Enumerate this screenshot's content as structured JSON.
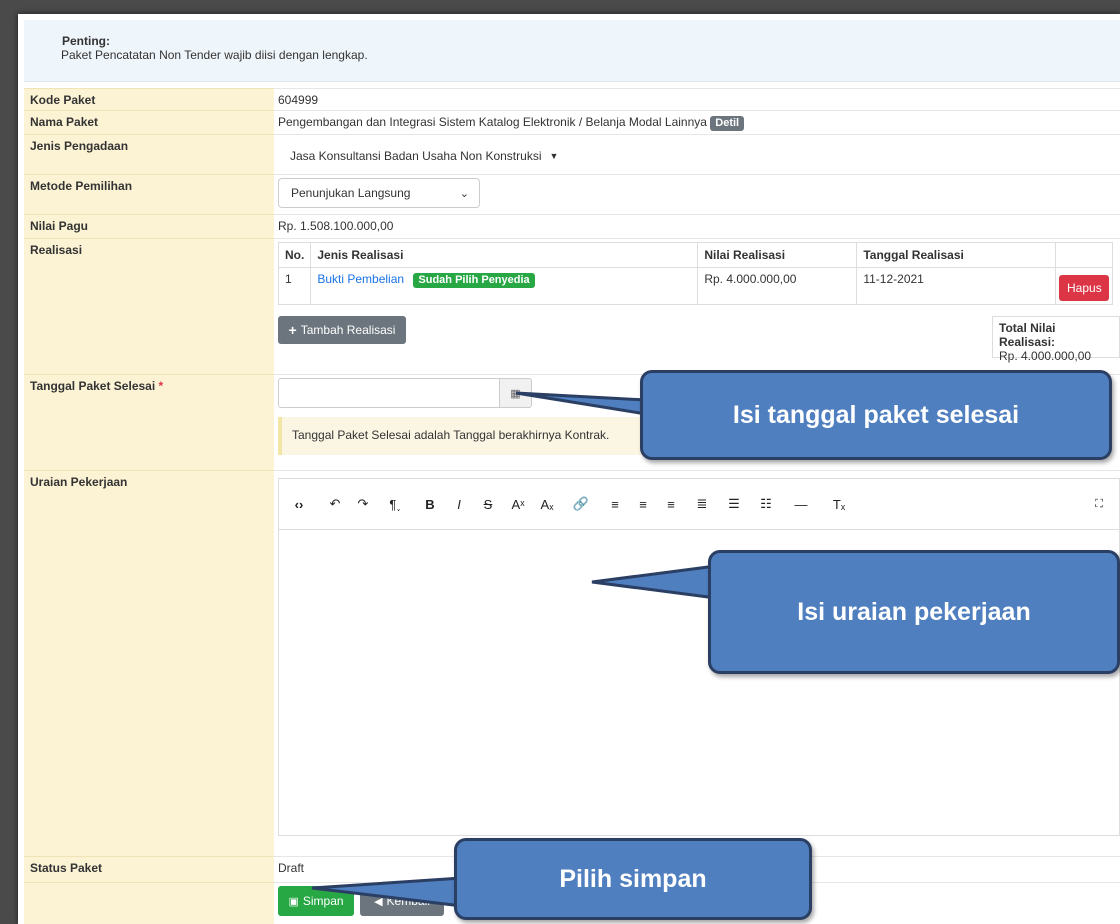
{
  "alert": {
    "title": "Penting:",
    "message": "Paket Pencatatan Non Tender wajib diisi dengan lengkap."
  },
  "form": {
    "kode_paket": {
      "label": "Kode Paket",
      "value": "604999"
    },
    "nama_paket": {
      "label": "Nama Paket",
      "value": "Pengembangan dan Integrasi Sistem Katalog Elektronik / Belanja Modal Lainnya",
      "badge": "Detil"
    },
    "jenis_pengadaan": {
      "label": "Jenis Pengadaan",
      "value": "Jasa Konsultansi Badan Usaha Non Konstruksi"
    },
    "metode_pemilihan": {
      "label": "Metode Pemilihan",
      "value": "Penunjukan Langsung"
    },
    "nilai_pagu": {
      "label": "Nilai Pagu",
      "value": "Rp. 1.508.100.000,00"
    },
    "realisasi": {
      "label": "Realisasi",
      "headers": [
        "No.",
        "Jenis Realisasi",
        "Nilai Realisasi",
        "Tanggal Realisasi"
      ],
      "rows": [
        {
          "no": "1",
          "jenis": "Bukti Pembelian",
          "badge": "Sudah Pilih Penyedia",
          "nilai": "Rp. 4.000.000,00",
          "tanggal": "11-12-2021",
          "action": "Hapus"
        }
      ],
      "add_button": "Tambah Realisasi",
      "total_label": "Total Nilai Realisasi:",
      "total_value": "Rp. 4.000.000,00"
    },
    "tanggal_selesai": {
      "label": "Tanggal Paket Selesai",
      "required": "*",
      "value": "",
      "hint": "Tanggal Paket Selesai adalah Tanggal berakhirnya Kontrak."
    },
    "uraian": {
      "label": "Uraian Pekerjaan"
    },
    "status": {
      "label": "Status Paket",
      "value": "Draft"
    },
    "buttons": {
      "simpan": "Simpan",
      "kembali": "Kembali"
    }
  },
  "callouts": {
    "tanggal": "Isi tanggal paket selesai",
    "uraian": "Isi uraian pekerjaan",
    "simpan": "Pilih simpan"
  },
  "colors": {
    "label_bg": "#fcf3d5",
    "callout": "#4f7fbf",
    "success": "#28a745",
    "danger": "#dc3545",
    "secondary": "#6c757d",
    "link": "#1a73e8"
  }
}
